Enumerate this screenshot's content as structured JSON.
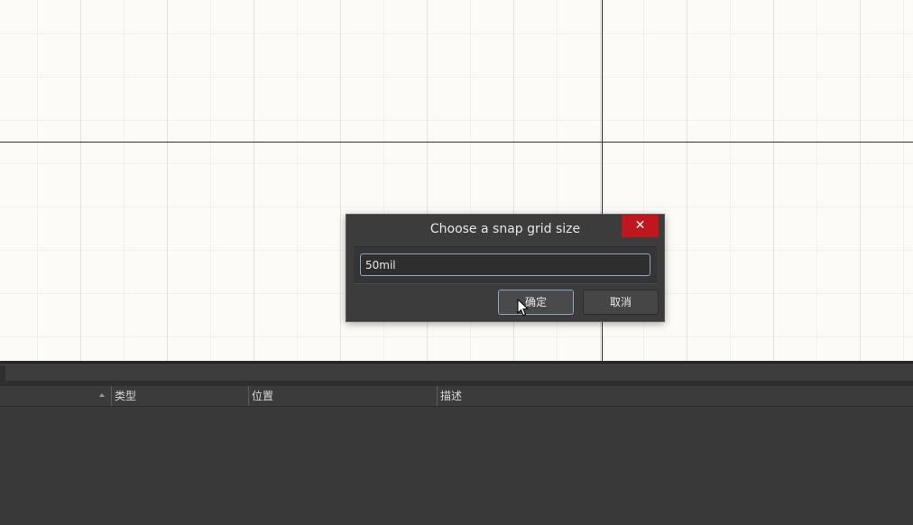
{
  "dialog": {
    "title": "Choose a snap grid size",
    "close_glyph": "✕",
    "input_value": "50mil",
    "ok_label": "确定",
    "cancel_label": "取消"
  },
  "panel": {
    "columns": [
      {
        "label": ""
      },
      {
        "label": "类型"
      },
      {
        "label": "位置"
      },
      {
        "label": "描述"
      }
    ]
  },
  "icons": {
    "sort": "sort-ascending-icon",
    "close": "close-icon",
    "pointer": "mouse-pointer-icon"
  },
  "colors": {
    "canvas": "#fdfbf7",
    "close_button": "#c0171e",
    "dialog_bg": "#3c3c3c",
    "focus_border": "#8aa6c8"
  }
}
